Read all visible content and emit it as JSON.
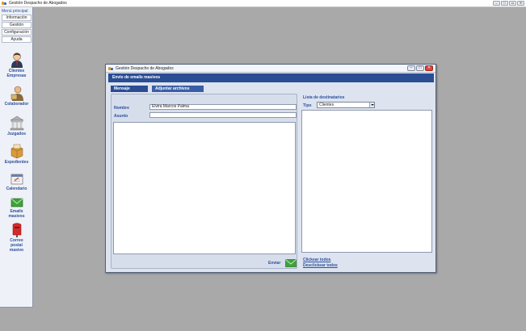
{
  "app": {
    "title": "Gestión Despacho de Abogados",
    "window_controls": [
      "–",
      "□",
      "▭",
      "✕"
    ]
  },
  "sidebar": {
    "menu_title": "Menú principal",
    "buttons": [
      {
        "label": "Información"
      },
      {
        "label": "Gestión"
      },
      {
        "label": "Configuración"
      },
      {
        "label": "Ayuda"
      }
    ],
    "items": [
      {
        "label_line1": "Clientes",
        "label_line2": "Empresas",
        "icon": "client-person-icon"
      },
      {
        "label_line1": "Colaborador",
        "label_line2": "",
        "icon": "collaborator-icon"
      },
      {
        "label_line1": "Juzgados",
        "label_line2": "",
        "icon": "courthouse-icon"
      },
      {
        "label_line1": "Expedientes",
        "label_line2": "",
        "icon": "case-files-box-icon"
      },
      {
        "label_line1": "Calendario",
        "label_line2": "",
        "icon": "calendar-icon"
      },
      {
        "label_line1": "Emails",
        "label_line2": "masivos",
        "icon": "email-envelope-icon"
      },
      {
        "label_line1": "Correo",
        "label_line2": "postal",
        "label_line3": "masivo",
        "icon": "mailbox-icon"
      }
    ]
  },
  "dialog": {
    "title": "Gestión Despacho de Abogados",
    "banner": "Envío de emails masivos",
    "controls": [
      "–",
      "□",
      "✕"
    ],
    "tabs": [
      {
        "label": "Mensaje",
        "active": true
      },
      {
        "label": "Adjuntar archivos",
        "active": false
      }
    ],
    "form": {
      "nombre_label": "Nombre",
      "nombre_value": "Elvira Marcos Palma",
      "asunto_label": "Asunto",
      "asunto_value": "",
      "body_value": "",
      "send_label": "Enviar"
    },
    "recipients": {
      "title": "Lista de destinatarios",
      "tipo_label": "Tipo",
      "tipo_value": "Clientes",
      "check_all": "Clickear todos",
      "uncheck_all": "Desclickear todos"
    }
  },
  "colors": {
    "accent": "#2a4d93",
    "label": "#2c4f9c",
    "desktop": "#a9a9a9",
    "panel": "#dde4f0"
  }
}
